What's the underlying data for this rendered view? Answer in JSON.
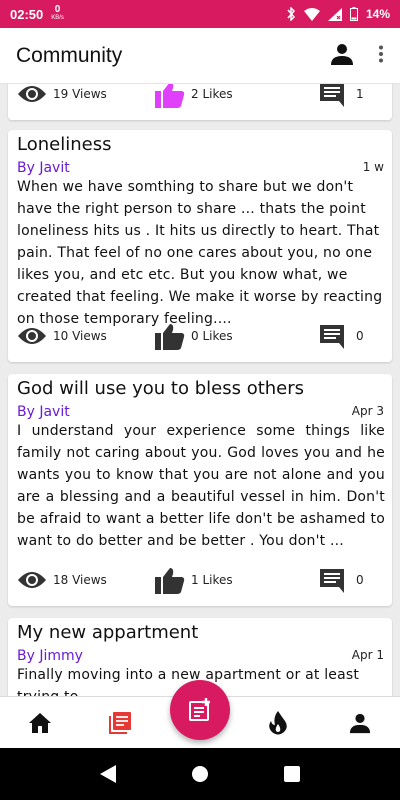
{
  "status": {
    "time": "02:50",
    "net_value": "0",
    "net_unit": "KB/s",
    "battery": "14%"
  },
  "app_bar": {
    "title": "Community"
  },
  "posts": [
    {
      "views": "19 Views",
      "likes": "2 Likes",
      "comments": "1",
      "liked": true
    },
    {
      "title": "Loneliness",
      "author": "By Javit",
      "time": "1 w",
      "body": "When we have somthing to share but we don't have the right person to share ... thats the point loneliness hits us . It hits us directly to  heart. That pain. That feel of no one cares about you, no one likes you, and etc etc. But you know what, we created that feeling. We make it worse by reacting on those temporary feeling....",
      "views": "10 Views",
      "likes": "0 Likes",
      "comments": "0",
      "liked": false
    },
    {
      "title": "God will use you to bless others",
      "author": "By Javit",
      "time": "Apr 3",
      "body": "I understand your experience some things like family not caring about you. God loves you and he wants you to know that you are not alone and you are a blessing and a beautiful vessel in him. Don't be afraid to want a better life don't be ashamed to want to do better and be better . You don't ...",
      "views": "18 Views",
      "likes": "1 Likes",
      "comments": "0",
      "liked": false
    },
    {
      "title": "My new appartment",
      "author": "By Jimmy",
      "time": "Apr 1",
      "body": "Finally moving into a new apartment or at least trying to"
    }
  ],
  "colors": {
    "accent": "#d81b60",
    "author": "#6a1bd6",
    "liked": "#e040fb",
    "nav_active": "#e53935"
  },
  "icons": {
    "views": "eye-icon",
    "likes": "thumbs-up-icon",
    "comments": "comment-icon",
    "home": "home-icon",
    "posts": "library-books-icon",
    "new_post": "new-post-icon",
    "trending": "fire-icon",
    "profile": "person-icon"
  }
}
